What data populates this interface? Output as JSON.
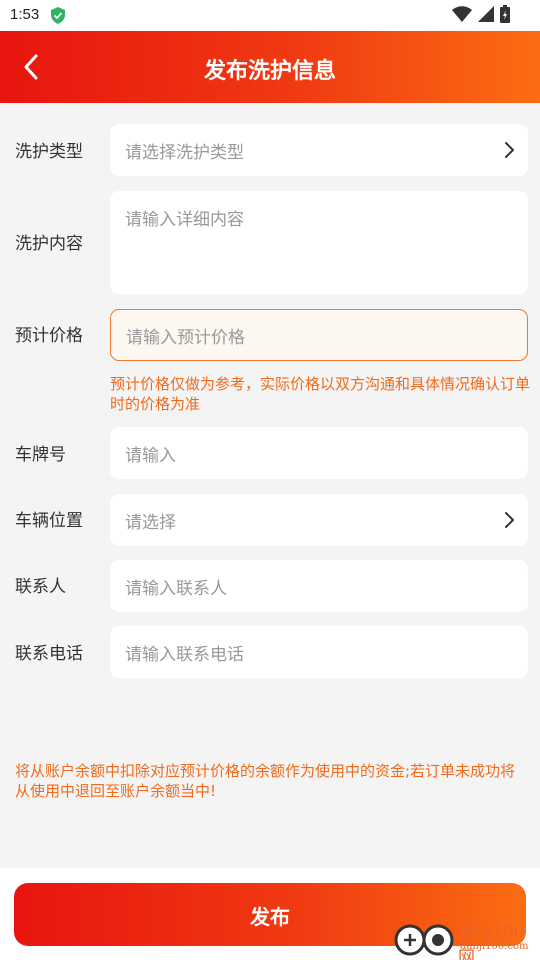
{
  "status_bar": {
    "time": "1:53"
  },
  "header": {
    "title": "发布洗护信息"
  },
  "form": {
    "wash_type": {
      "label": "洗护类型",
      "placeholder": "请选择洗护类型"
    },
    "wash_content": {
      "label": "洗护内容",
      "placeholder": "请输入详细内容"
    },
    "estimated_price": {
      "label": "预计价格",
      "placeholder": "请输入预计价格",
      "hint": "预计价格仅做为参考，实际价格以双方沟通和具体情况确认订单时的价格为准"
    },
    "plate_number": {
      "label": "车牌号",
      "placeholder": "请输入"
    },
    "vehicle_location": {
      "label": "车辆位置",
      "placeholder": "请选择"
    },
    "contact_person": {
      "label": "联系人",
      "placeholder": "请输入联系人"
    },
    "contact_phone": {
      "label": "联系电话",
      "placeholder": "请输入联系电话"
    }
  },
  "notice": "将从账户余额中扣除对应预计价格的余额作为使用中的资金;若订单未成功将从使用中退回至账户余额当中!",
  "publish_button": {
    "label": "发布"
  },
  "watermark": {
    "text": "单机100网",
    "sub": "danji100.com"
  },
  "colors": {
    "accent_start": "#e8150f",
    "accent_end": "#fb6d12",
    "hint": "#f26a1a"
  }
}
